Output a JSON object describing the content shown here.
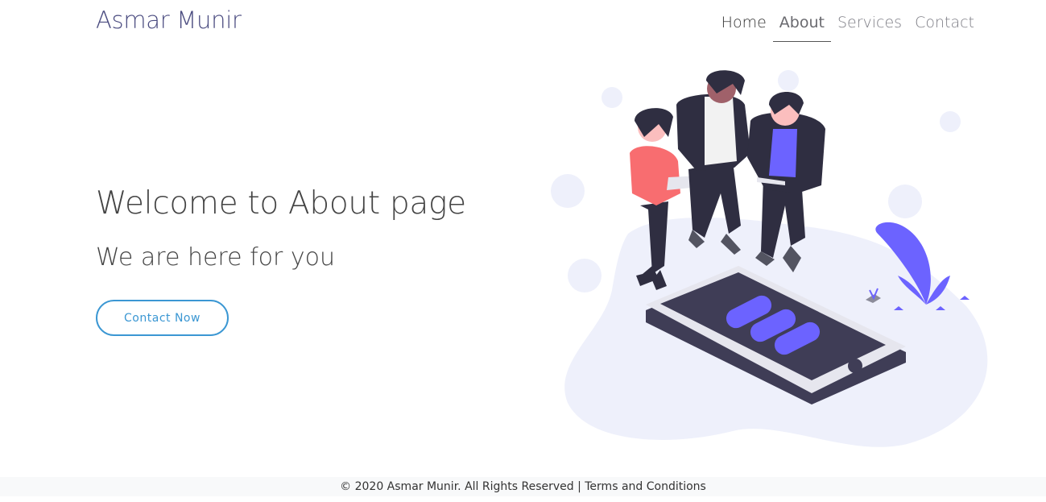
{
  "brand": {
    "name": "Asmar Munir"
  },
  "nav": {
    "items": [
      {
        "label": "Home"
      },
      {
        "label": "About"
      },
      {
        "label": "Services"
      },
      {
        "label": "Contact"
      }
    ]
  },
  "hero": {
    "title": "Welcome to About page",
    "subtitle": "We are here for you",
    "cta_label": "Contact Now"
  },
  "footer": {
    "text": "© 2020 Asmar Munir. All Rights Reserved | Terms and Conditions"
  },
  "colors": {
    "brand": "#4b4c80",
    "accent_button": "#3b97d3",
    "illustration_accent": "#6c63ff",
    "illustration_bg": "#eef0fb",
    "footer_bg": "#f8f9fa"
  }
}
